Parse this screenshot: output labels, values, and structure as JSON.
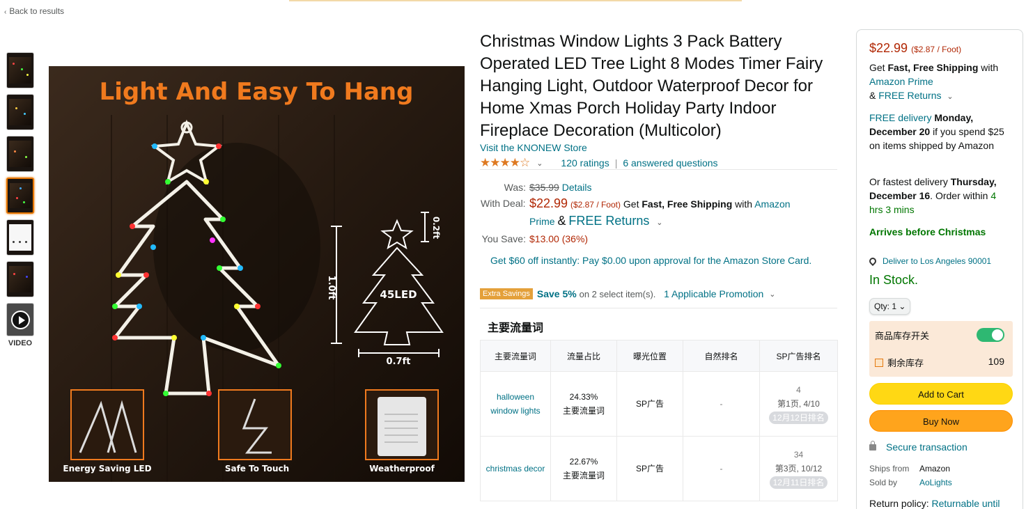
{
  "nav": {
    "back_label": "Back to results"
  },
  "gallery": {
    "video_label": "VIDEO",
    "main_image": {
      "headline": "Light And Easy To Hang",
      "dim_height": "1.0ft",
      "dim_top": "0.2ft",
      "dim_width": "0.7ft",
      "led_count": "45LED",
      "features": [
        "Energy Saving LED",
        "Safe To Touch",
        "Weatherproof"
      ]
    }
  },
  "product": {
    "title": "Christmas Window Lights 3 Pack Battery Operated LED Tree Light 8 Modes Timer Fairy Hanging Light, Outdoor Waterproof Decor for Home Xmas Porch Holiday Party Indoor Fireplace Decoration (Multicolor)",
    "store_link": "Visit the KNONEW Store",
    "stars_glyph": "★★★★☆",
    "rating": 4.5,
    "ratings_text": "120 ratings",
    "answered_text": "6 answered questions"
  },
  "pricing": {
    "was_label": "Was:",
    "was_price": "$35.99",
    "details_link": "Details",
    "deal_label": "With Deal:",
    "deal_price": "$22.99",
    "unit_price": "($2.87 / Foot)",
    "get_text": "Get",
    "fast_free": "Fast, Free Shipping",
    "with_text": "with",
    "amazon_prime": "Amazon Prime",
    "amp": "&",
    "free_returns": "FREE Returns",
    "save_label": "You Save:",
    "save_amount": "$13.00 (36%)",
    "store_card_offer": "Get $60 off instantly: Pay $0.00 upon approval for the Amazon Store Card."
  },
  "extra": {
    "badge": "Extra Savings",
    "save_text": "Save 5%",
    "on_text": "on 2 select item(s).",
    "promotion_link": "1 Applicable Promotion"
  },
  "traffic": {
    "title": "主要流量词",
    "headers": [
      "主要流量词",
      "流量占比",
      "曝光位置",
      "自然排名",
      "SP广告排名"
    ],
    "rows": [
      {
        "keyword": "halloween window lights",
        "share": "24.33%",
        "share_note": "主要流量词",
        "position": "SP广告",
        "organic": "-",
        "sp_rank": "4",
        "sp_page": "第1页, 4/10",
        "sp_date": "12月12日排名"
      },
      {
        "keyword": "christmas decor",
        "share": "22.67%",
        "share_note": "主要流量词",
        "position": "SP广告",
        "organic": "-",
        "sp_rank": "34",
        "sp_page": "第3页, 10/12",
        "sp_date": "12月11日排名"
      }
    ]
  },
  "buybox": {
    "price": "$22.99",
    "unit_price": "($2.87 / Foot)",
    "get": "Get",
    "fast_free": "Fast, Free Shipping",
    "with": "with",
    "amazon_prime": "Amazon Prime",
    "amp": "&",
    "free_returns": "FREE Returns",
    "free_delivery": "FREE delivery",
    "delivery_date": "Monday, December 20",
    "delivery_cond": "if you spend $25 on items shipped by Amazon",
    "fastest_prefix": "Or fastest delivery",
    "fastest_date": "Thursday, December 16",
    "order_within": ". Order within",
    "countdown": "4 hrs 3 mins",
    "arrives": "Arrives before Christmas",
    "deliver_to": "Deliver to Los Angeles 90001",
    "stock": "In Stock.",
    "qty_label": "Qty: 1",
    "inventory_switch": "商品库存开关",
    "inventory_label": "剩余库存",
    "inventory_value": "109",
    "add_to_cart": "Add to Cart",
    "buy_now": "Buy Now",
    "secure": "Secure transaction",
    "ships_from_label": "Ships from",
    "ships_from": "Amazon",
    "sold_by_label": "Sold by",
    "sold_by": "AoLights",
    "return_label": "Return policy:",
    "return_link": "Returnable until"
  },
  "colors": {
    "accent_orange": "#e77600",
    "link": "#007185",
    "price_red": "#b12704",
    "in_stock_green": "#007600",
    "cart_yellow": "#ffd814",
    "buy_orange": "#ffa41c"
  }
}
